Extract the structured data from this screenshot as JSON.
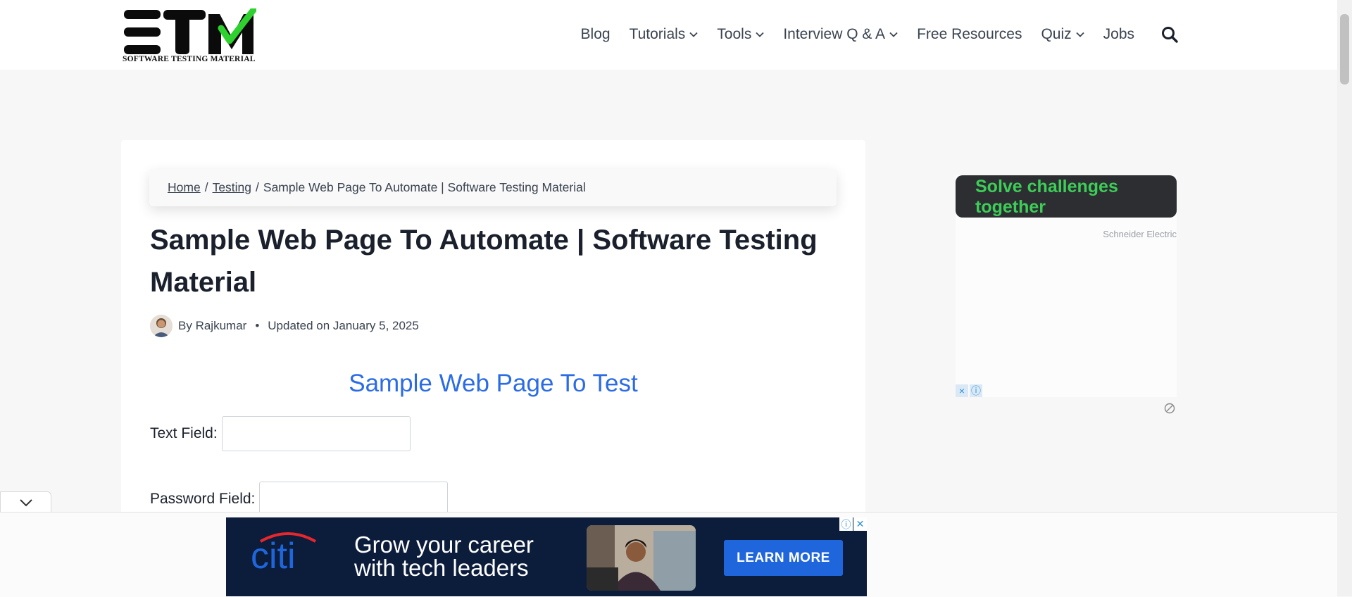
{
  "header": {
    "logo_text": "ST",
    "logo_caption": "SOFTWARE TESTING MATERIAL",
    "nav": [
      {
        "label": "Blog",
        "has_dropdown": false
      },
      {
        "label": "Tutorials",
        "has_dropdown": true
      },
      {
        "label": "Tools",
        "has_dropdown": true
      },
      {
        "label": "Interview Q & A",
        "has_dropdown": true
      },
      {
        "label": "Free Resources",
        "has_dropdown": false
      },
      {
        "label": "Quiz",
        "has_dropdown": true
      },
      {
        "label": "Jobs",
        "has_dropdown": false
      }
    ],
    "search_icon": "search-icon"
  },
  "breadcrumb": {
    "home": "Home",
    "sep1": "/",
    "section": "Testing",
    "sep2": "/",
    "current": "Sample Web Page To Automate | Software Testing Material"
  },
  "article": {
    "title": "Sample Web Page To Automate | Software Testing Material",
    "by": "By",
    "author": "Rajkumar",
    "dot": "•",
    "updated": "Updated on January 5, 2025"
  },
  "sample": {
    "heading": "Sample Web Page To Test",
    "text_field_label": "Text Field:",
    "text_field_value": "",
    "password_field_label": "Password Field:",
    "password_field_value": ""
  },
  "side_ad": {
    "headline": "Solve challenges together",
    "brand": "Schneider Electric",
    "close_icon": "×",
    "info_icon": "ⓘ"
  },
  "bottom_ad": {
    "logo": "citi",
    "tagline_line1": "Grow your career",
    "tagline_line2": "with tech leaders",
    "cta": "LEARN MORE",
    "info_icon": "ⓘ",
    "close_icon": "✕"
  },
  "colors": {
    "accent": "#2b6ce6",
    "logo_green": "#2fd12f",
    "ad_green": "#3dcd58",
    "citi_blue": "#1f66dd",
    "ad_bg": "#0c1d3c"
  }
}
